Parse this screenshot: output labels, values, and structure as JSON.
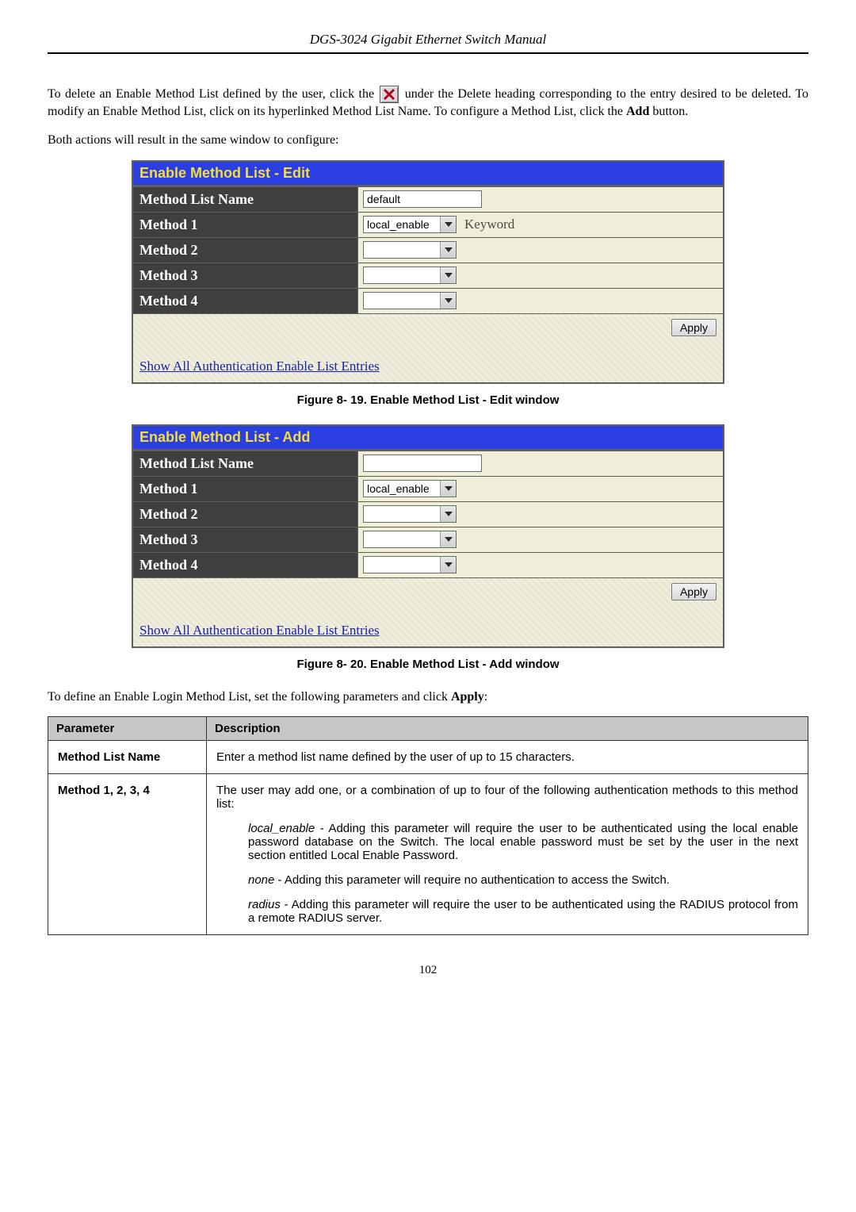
{
  "header": {
    "title": "DGS-3024 Gigabit Ethernet Switch Manual"
  },
  "intro": {
    "p1a": "To delete an Enable Method List defined by the user, click the ",
    "p1b": " under the Delete heading corresponding to the entry desired to be deleted. To modify an Enable Method List, click on its hyperlinked Method List Name. To configure a Method List, click the ",
    "addWord": "Add",
    "p1c": " button.",
    "p2": "Both actions will result in the same window to configure:"
  },
  "editPanel": {
    "title": "Enable Method List - Edit",
    "rows": {
      "nameLabel": "Method List Name",
      "nameValue": "default",
      "m1Label": "Method 1",
      "m1Value": "local_enable",
      "m1Keyword": "Keyword",
      "m2Label": "Method 2",
      "m2Value": "",
      "m3Label": "Method 3",
      "m3Value": "",
      "m4Label": "Method 4",
      "m4Value": ""
    },
    "apply": "Apply",
    "link": "Show All Authentication Enable List Entries",
    "caption": "Figure 8- 19. Enable Method List - Edit window"
  },
  "addPanel": {
    "title": "Enable Method List - Add",
    "rows": {
      "nameLabel": "Method List Name",
      "nameValue": "",
      "m1Label": "Method 1",
      "m1Value": "local_enable",
      "m2Label": "Method 2",
      "m2Value": "",
      "m3Label": "Method 3",
      "m3Value": "",
      "m4Label": "Method 4",
      "m4Value": ""
    },
    "apply": "Apply",
    "link": "Show All Authentication Enable List Entries",
    "caption": "Figure 8- 20. Enable Method List - Add window"
  },
  "definePara": {
    "a": "To define an Enable Login Method List, set the following parameters and click ",
    "applyWord": "Apply",
    "b": ":"
  },
  "table": {
    "headParam": "Parameter",
    "headDesc": "Description",
    "row1Label": "Method List Name",
    "row1Desc": "Enter a method list name defined by the user of up to 15 characters.",
    "row2Label": "Method 1, 2, 3, 4",
    "row2Intro": "The user may add one, or a combination of up to four of the following authentication methods to this method list:",
    "localKw": "local_enable",
    "localDesc": " - Adding this parameter will require the user to be authenticated using the local enable password database on the Switch. The local enable password must be set by the user in the next section entitled Local Enable Password.",
    "noneKw": "none",
    "noneDesc": " - Adding this parameter will require no authentication to access the Switch.",
    "radiusKw": "radius",
    "radiusDesc": " - Adding this parameter will require the user to be authenticated using the RADIUS protocol from a remote RADIUS server."
  },
  "pageNumber": "102"
}
